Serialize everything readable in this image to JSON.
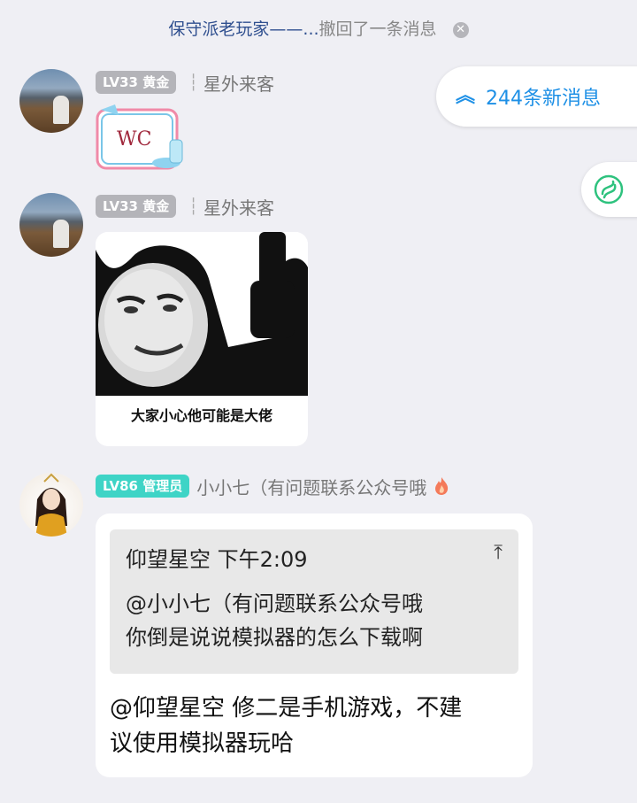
{
  "recall_notice": {
    "nickname": "保守派老玩家——...",
    "text": "撤回了一条消息",
    "close_icon": "close-icon"
  },
  "new_messages": {
    "icon": "double-chevron-up-icon",
    "label": "244条新消息",
    "color": "#1e90e6"
  },
  "side_button": {
    "icon": "swirl-icon",
    "color": "#2ec27e"
  },
  "messages": [
    {
      "badge": "LV33 黄金",
      "sender": "星外来客",
      "type": "sticker",
      "sticker_text": "WC"
    },
    {
      "badge": "LV33 黄金",
      "sender": "星外来客",
      "type": "image",
      "caption": "大家小心他可能是大佬"
    },
    {
      "badge": "LV86 管理员",
      "sender": "小小七（有问题联系公众号哦",
      "type": "reply",
      "quote": {
        "author": "仰望星空",
        "time": "下午2:09",
        "line1": "@小小七（有问题联系公众号哦",
        "line2": "你倒是说说模拟器的怎么下载啊"
      },
      "text_line1": "@仰望星空 修二是手机游戏，不建",
      "text_line2": "议使用模拟器玩哈"
    }
  ],
  "colors": {
    "background": "#efeff4",
    "badge_gray": "#b4b4b9",
    "badge_admin": "#3ed4c6"
  }
}
